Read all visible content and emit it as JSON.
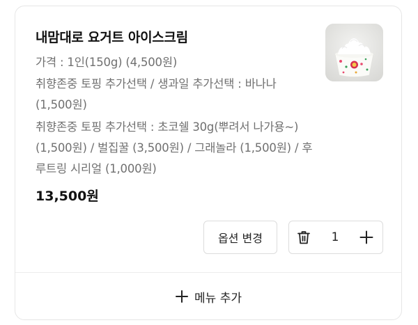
{
  "cart_item": {
    "title": "내맘대로 요거트 아이스크림",
    "options": {
      "price_line": "가격 : 1인(150g)  (4,500원)",
      "fruit_line": "취향존중 토핑 추가선택 / 생과일 추가선택 : 바나나 (1,500원)",
      "topping_line": "취향존중 토핑 추가선택 : 초코쉘 30g(뿌려서 나가용~) (1,500원) / 벌집꿀 (3,500원) / 그래놀라 (1,500원) / 후루트링 시리얼 (1,000원)"
    },
    "total_price": "13,500원",
    "image_icon": "yogurt-ice-cream-photo"
  },
  "actions": {
    "option_change_label": "옵션 변경",
    "quantity": "1",
    "delete_icon": "trash-icon",
    "plus_icon": "plus-icon"
  },
  "footer": {
    "add_menu_label": "메뉴 추가",
    "add_icon": "plus-icon"
  },
  "colors": {
    "text_primary": "#111111",
    "text_secondary": "#707070",
    "border": "#dcdcdc"
  }
}
